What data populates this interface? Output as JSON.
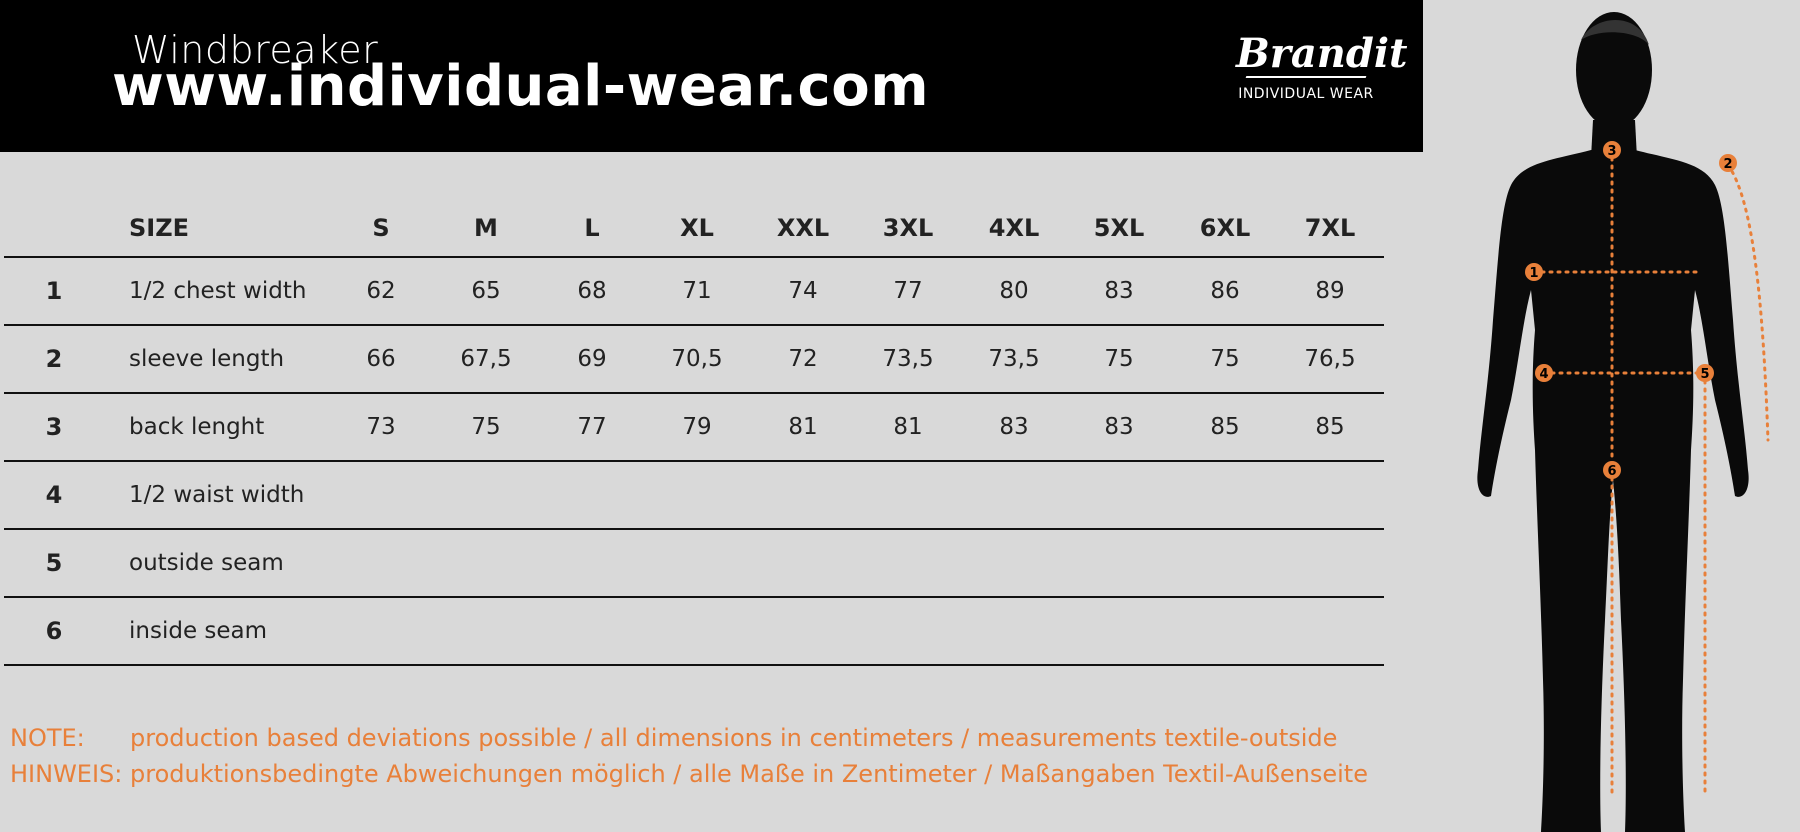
{
  "header": {
    "product": "Windbreaker",
    "url": "www.individual-wear.com",
    "brand_name": "Brandit",
    "brand_tagline": "INDIVIDUAL WEAR"
  },
  "table": {
    "size_header": "SIZE",
    "sizes": [
      "S",
      "M",
      "L",
      "XL",
      "XXL",
      "3XL",
      "4XL",
      "5XL",
      "6XL",
      "7XL"
    ],
    "rows": [
      {
        "num": "1",
        "label": "1/2 chest width",
        "values": [
          "62",
          "65",
          "68",
          "71",
          "74",
          "77",
          "80",
          "83",
          "86",
          "89"
        ]
      },
      {
        "num": "2",
        "label": "sleeve length",
        "values": [
          "66",
          "67,5",
          "69",
          "70,5",
          "72",
          "73,5",
          "73,5",
          "75",
          "75",
          "76,5"
        ]
      },
      {
        "num": "3",
        "label": "back lenght",
        "values": [
          "73",
          "75",
          "77",
          "79",
          "81",
          "81",
          "83",
          "83",
          "85",
          "85"
        ]
      },
      {
        "num": "4",
        "label": "1/2 waist width",
        "values": [
          "",
          "",
          "",
          "",
          "",
          "",
          "",
          "",
          "",
          ""
        ]
      },
      {
        "num": "5",
        "label": "outside seam",
        "values": [
          "",
          "",
          "",
          "",
          "",
          "",
          "",
          "",
          "",
          ""
        ]
      },
      {
        "num": "6",
        "label": "inside seam",
        "values": [
          "",
          "",
          "",
          "",
          "",
          "",
          "",
          "",
          "",
          ""
        ]
      }
    ]
  },
  "notes": {
    "note_label": "NOTE:",
    "note_text": "production based deviations possible / all dimensions in centimeters / measurements textile-outside",
    "hinweis_label": "HINWEIS:",
    "hinweis_text": "produktionsbedingte Abweichungen möglich / alle Maße in Zentimeter / Maßangaben Textil-Außenseite"
  },
  "figure": {
    "markers": [
      "1",
      "2",
      "3",
      "4",
      "5",
      "6"
    ]
  },
  "colors": {
    "accent": "#e8803a",
    "header_bg": "#000000",
    "page_bg": "#d9d9d9"
  }
}
